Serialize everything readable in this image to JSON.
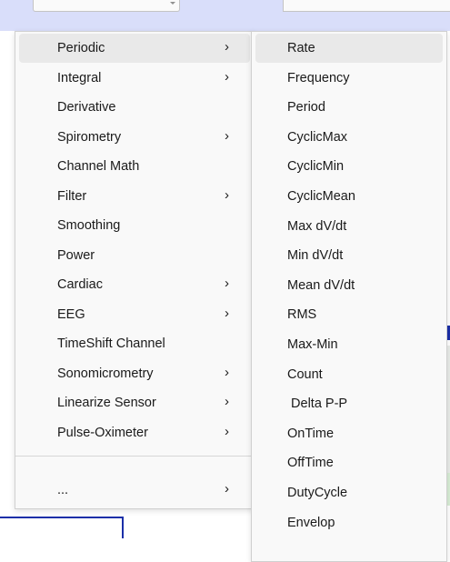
{
  "main_menu": {
    "items": [
      {
        "label": "Periodic",
        "has_submenu": true,
        "active": true
      },
      {
        "label": "Integral",
        "has_submenu": true
      },
      {
        "label": "Derivative",
        "has_submenu": false
      },
      {
        "label": "Spirometry",
        "has_submenu": true
      },
      {
        "label": "Channel Math",
        "has_submenu": false
      },
      {
        "label": "Filter",
        "has_submenu": true
      },
      {
        "label": "Smoothing",
        "has_submenu": false
      },
      {
        "label": "Power",
        "has_submenu": false
      },
      {
        "label": "Cardiac",
        "has_submenu": true
      },
      {
        "label": "EEG",
        "has_submenu": true
      },
      {
        "label": "TimeShift Channel",
        "has_submenu": false
      },
      {
        "label": "Sonomicrometry",
        "has_submenu": true
      },
      {
        "label": "Linearize Sensor",
        "has_submenu": true
      },
      {
        "label": "Pulse-Oximeter",
        "has_submenu": true
      }
    ],
    "more_item": {
      "label": "...",
      "has_submenu": true
    },
    "submenu_arrow": "›"
  },
  "sub_menu": {
    "items": [
      {
        "label": "Rate",
        "active": true
      },
      {
        "label": "Frequency"
      },
      {
        "label": "Period"
      },
      {
        "label": "CyclicMax"
      },
      {
        "label": "CyclicMin"
      },
      {
        "label": "CyclicMean"
      },
      {
        "label": "Max dV/dt"
      },
      {
        "label": "Min dV/dt"
      },
      {
        "label": "Mean dV/dt"
      },
      {
        "label": "RMS"
      },
      {
        "label": "Max-Min"
      },
      {
        "label": "Count"
      },
      {
        "label": " Delta P-P"
      },
      {
        "label": "OnTime"
      },
      {
        "label": "OffTime"
      },
      {
        "label": "DutyCycle"
      },
      {
        "label": "Envelop"
      }
    ]
  },
  "colors": {
    "menu_background": "#f9f9f9",
    "hover_highlight": "#e9e9e9",
    "top_strip": "#d9defa",
    "plot_line": "#1b2fa8"
  },
  "icons": {
    "submenu_arrow": "chevron-right-icon",
    "dropdown": "chevron-down-icon"
  }
}
